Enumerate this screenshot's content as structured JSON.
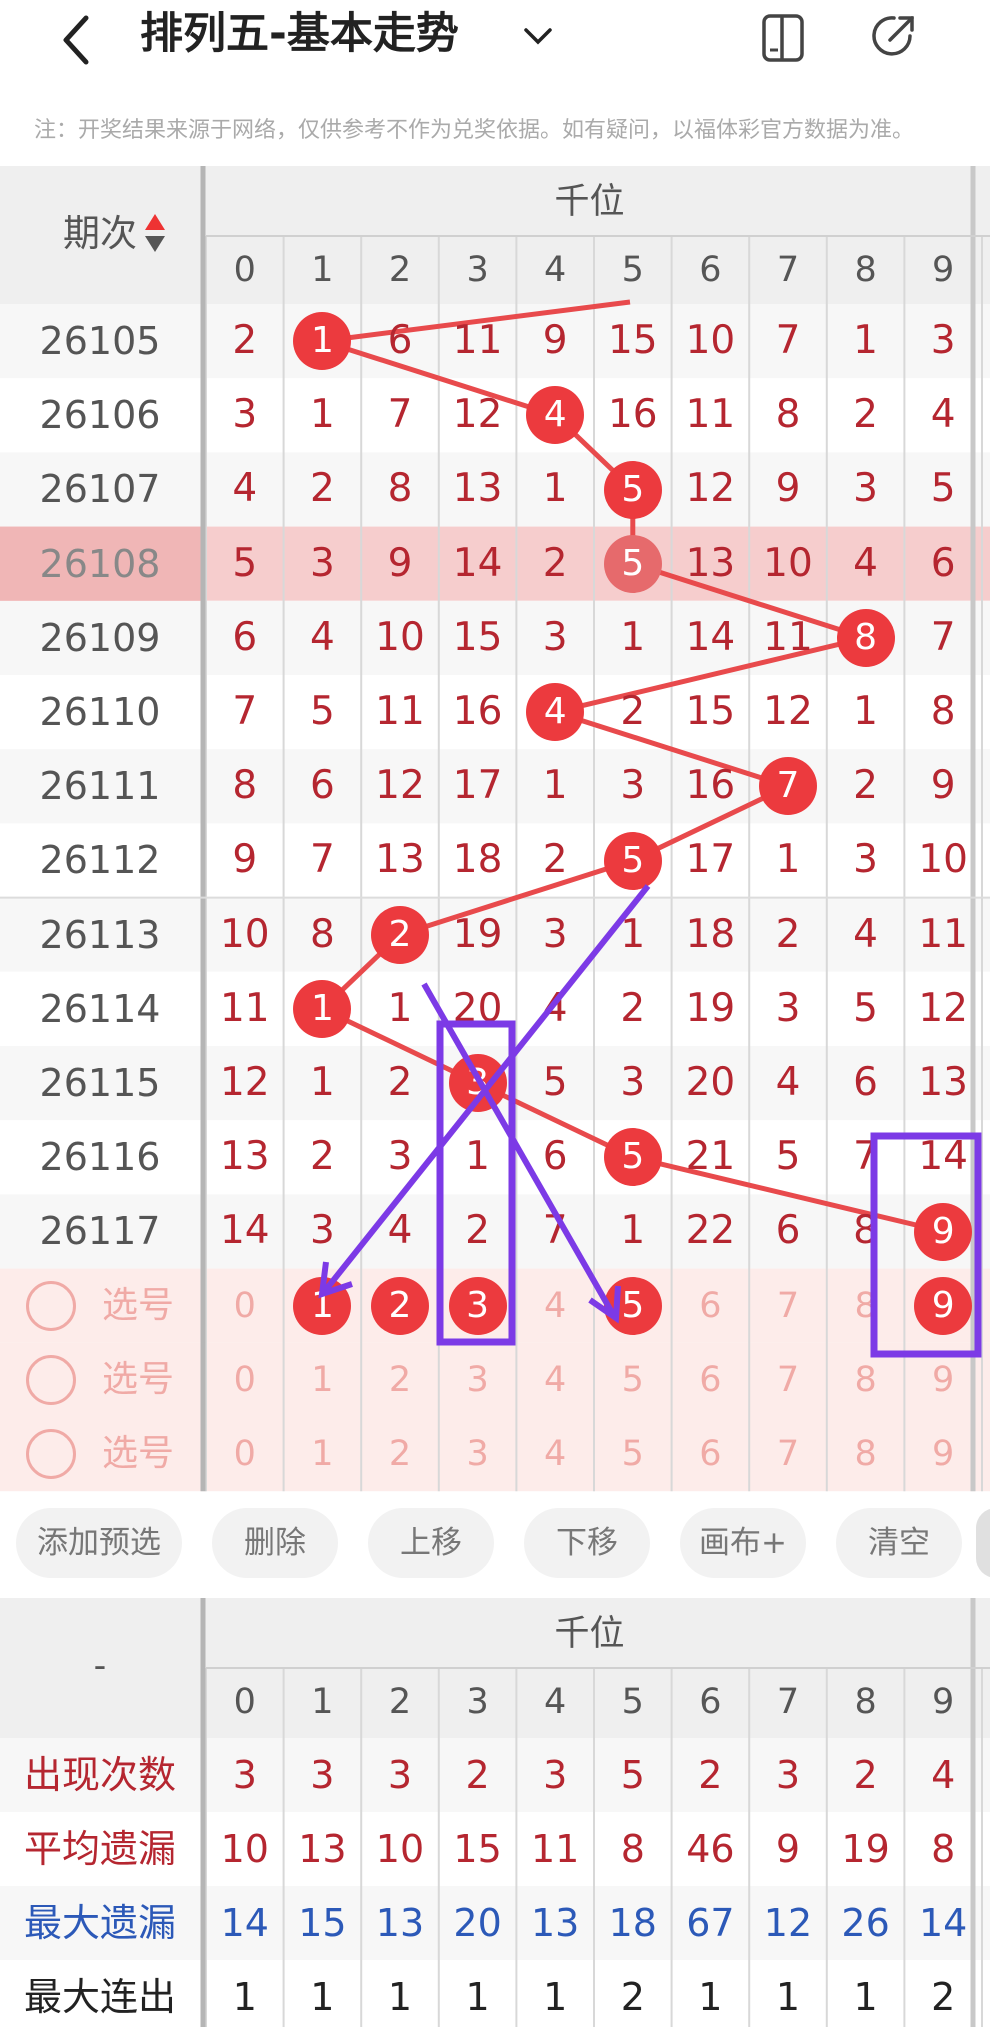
{
  "header": {
    "title": "排列五-基本走势",
    "notice": "注：开奖结果来源于网络，仅供参考不作为兑奖依据。如有疑问，以福体彩官方数据为准。"
  },
  "icons": [
    "back-icon",
    "chevron-down-icon",
    "device-icon",
    "share-icon",
    "sort-icon"
  ],
  "trend": {
    "period_header": "期次",
    "group_header": "千位",
    "digits": [
      "0",
      "1",
      "2",
      "3",
      "4",
      "5",
      "6",
      "7",
      "8",
      "9"
    ],
    "rows": [
      {
        "period": "26105",
        "cells": [
          "2",
          "1",
          "6",
          "11",
          "9",
          "15",
          "10",
          "7",
          "1",
          "3"
        ],
        "hit": 1
      },
      {
        "period": "26106",
        "cells": [
          "3",
          "1",
          "7",
          "12",
          "4",
          "16",
          "11",
          "8",
          "2",
          "4"
        ],
        "hit": 4
      },
      {
        "period": "26107",
        "cells": [
          "4",
          "2",
          "8",
          "13",
          "1",
          "5",
          "12",
          "9",
          "3",
          "5"
        ],
        "hit": 5
      },
      {
        "period": "26108",
        "cells": [
          "5",
          "3",
          "9",
          "14",
          "2",
          "5",
          "13",
          "10",
          "4",
          "6"
        ],
        "hit": 5
      },
      {
        "period": "26109",
        "cells": [
          "6",
          "4",
          "10",
          "15",
          "3",
          "1",
          "14",
          "11",
          "8",
          "7"
        ],
        "hit": 8
      },
      {
        "period": "26110",
        "cells": [
          "7",
          "5",
          "11",
          "16",
          "4",
          "2",
          "15",
          "12",
          "1",
          "8"
        ],
        "hit": 4
      },
      {
        "period": "26111",
        "cells": [
          "8",
          "6",
          "12",
          "17",
          "1",
          "3",
          "16",
          "7",
          "2",
          "9"
        ],
        "hit": 7
      },
      {
        "period": "26112",
        "cells": [
          "9",
          "7",
          "13",
          "18",
          "2",
          "5",
          "17",
          "1",
          "3",
          "10"
        ],
        "hit": 5
      },
      {
        "period": "26113",
        "cells": [
          "10",
          "8",
          "2",
          "19",
          "3",
          "1",
          "18",
          "2",
          "4",
          "11"
        ],
        "hit": 2
      },
      {
        "period": "26114",
        "cells": [
          "11",
          "1",
          "1",
          "20",
          "4",
          "2",
          "19",
          "3",
          "5",
          "12"
        ],
        "hit": 1
      },
      {
        "period": "26115",
        "cells": [
          "12",
          "1",
          "2",
          "3",
          "5",
          "3",
          "20",
          "4",
          "6",
          "13"
        ],
        "hit": 3
      },
      {
        "period": "26116",
        "cells": [
          "13",
          "2",
          "3",
          "1",
          "6",
          "5",
          "21",
          "5",
          "7",
          "14"
        ],
        "hit": 5
      },
      {
        "period": "26117",
        "cells": [
          "14",
          "3",
          "4",
          "2",
          "7",
          "1",
          "22",
          "6",
          "8",
          "9"
        ],
        "hit": 9
      }
    ],
    "select_rows": [
      {
        "label": "选号",
        "cells": [
          "0",
          "1",
          "2",
          "3",
          "4",
          "5",
          "6",
          "7",
          "8",
          "9"
        ],
        "picked": [
          1,
          2,
          3,
          5,
          9
        ]
      },
      {
        "label": "选号",
        "cells": [
          "0",
          "1",
          "2",
          "3",
          "4",
          "5",
          "6",
          "7",
          "8",
          "9"
        ],
        "picked": []
      },
      {
        "label": "选号",
        "cells": [
          "0",
          "1",
          "2",
          "3",
          "4",
          "5",
          "6",
          "7",
          "8",
          "9"
        ],
        "picked": []
      }
    ]
  },
  "toolbar": {
    "buttons": [
      "添加预选",
      "删除",
      "上移",
      "下移",
      "画布+",
      "清空"
    ]
  },
  "stats": {
    "corner": "-",
    "group_header": "千位",
    "digits": [
      "0",
      "1",
      "2",
      "3",
      "4",
      "5",
      "6",
      "7",
      "8",
      "9"
    ],
    "rows": [
      {
        "label": "出现次数",
        "values": [
          "3",
          "3",
          "3",
          "2",
          "3",
          "5",
          "2",
          "3",
          "2",
          "4"
        ],
        "color": "#b52630"
      },
      {
        "label": "平均遗漏",
        "values": [
          "10",
          "13",
          "10",
          "15",
          "11",
          "8",
          "46",
          "9",
          "19",
          "8"
        ],
        "color": "#b52630"
      },
      {
        "label": "最大遗漏",
        "values": [
          "14",
          "15",
          "13",
          "20",
          "13",
          "18",
          "67",
          "12",
          "26",
          "14"
        ],
        "color": "#2c59b8"
      },
      {
        "label": "最大连出",
        "values": [
          "1",
          "1",
          "1",
          "1",
          "1",
          "2",
          "1",
          "1",
          "1",
          "2"
        ],
        "color": "#222"
      }
    ]
  },
  "colors": {
    "ball": "#ec3a3e",
    "line": "#e84a4c",
    "accent_purple": "#7c3ae6",
    "number": "#b52630",
    "highlight_row": "#f6cdcd"
  }
}
